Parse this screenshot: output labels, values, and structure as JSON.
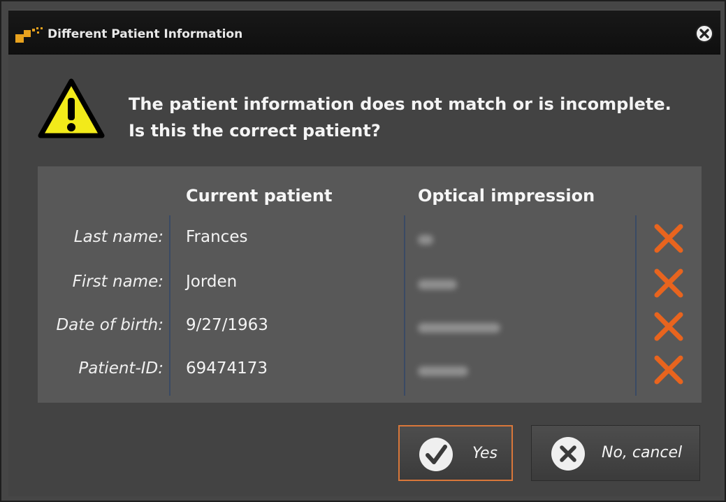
{
  "dialog": {
    "title": "Different Patient Information",
    "message_line1": "The patient information does not match or is incomplete.",
    "message_line2": "Is this the correct patient?"
  },
  "table": {
    "col_current": "Current patient",
    "col_optical": "Optical impression",
    "rows": [
      {
        "label": "Last name:",
        "current": "Frances",
        "optical_visible": false,
        "match": false
      },
      {
        "label": "First name:",
        "current": "Jorden",
        "optical_visible": false,
        "match": false
      },
      {
        "label": "Date of birth:",
        "current": "9/27/1963",
        "optical_visible": false,
        "match": false
      },
      {
        "label": "Patient-ID:",
        "current": "69474173",
        "optical_visible": false,
        "match": false
      }
    ]
  },
  "buttons": {
    "yes_label": "Yes",
    "no_label": "No, cancel"
  },
  "icons": {
    "app": "app-logo-icon",
    "close": "close-icon",
    "warning": "warning-triangle-icon",
    "mismatch": "cross-icon",
    "yes": "checkmark-circle-icon",
    "no": "x-circle-icon"
  },
  "colors": {
    "accent": "#e8641e",
    "primary_button_border": "#d9773a",
    "warning_fill": "#f2ea1a"
  }
}
